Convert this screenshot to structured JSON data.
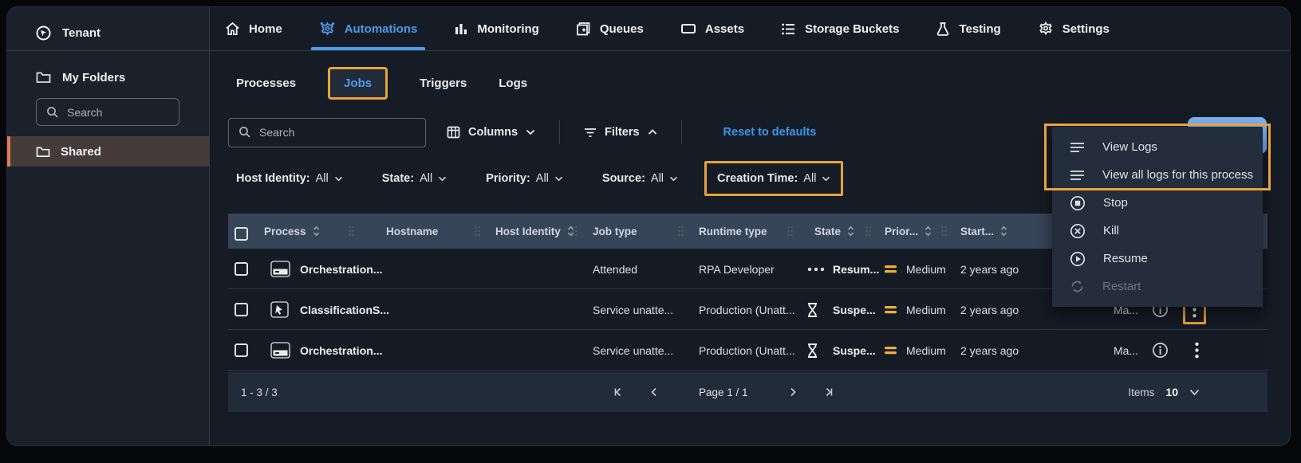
{
  "colors": {
    "accent_blue": "#4f9ae8",
    "link_blue": "#3e96e8",
    "annotation_orange": "#e8a33c",
    "priority_amber": "#efad3d",
    "shared_accent_orange": "#e07b52",
    "table_header_bg": "#384559"
  },
  "sidebar": {
    "tenant_label": "Tenant",
    "my_folders_label": "My Folders",
    "search_placeholder": "Search",
    "shared_label": "Shared"
  },
  "topnav": {
    "items": [
      {
        "label": "Home",
        "icon": "home-icon",
        "active": false
      },
      {
        "label": "Automations",
        "icon": "automations-gear-icon",
        "active": true
      },
      {
        "label": "Monitoring",
        "icon": "bar-chart-icon",
        "active": false
      },
      {
        "label": "Queues",
        "icon": "queues-icon",
        "active": false
      },
      {
        "label": "Assets",
        "icon": "assets-icon",
        "active": false
      },
      {
        "label": "Storage Buckets",
        "icon": "storage-buckets-icon",
        "active": false
      },
      {
        "label": "Testing",
        "icon": "flask-icon",
        "active": false
      },
      {
        "label": "Settings",
        "icon": "gear-icon",
        "active": false
      }
    ]
  },
  "tabs": {
    "items": [
      {
        "label": "Processes",
        "active": false
      },
      {
        "label": "Jobs",
        "active": true,
        "annotated": true
      },
      {
        "label": "Triggers",
        "active": false
      },
      {
        "label": "Logs",
        "active": false
      }
    ]
  },
  "toolbar": {
    "search_placeholder": "Search",
    "columns_label": "Columns",
    "filters_label": "Filters",
    "reset_label": "Reset to defaults"
  },
  "filters": {
    "items": [
      {
        "label": "Host Identity:",
        "value": "All",
        "annotated": false
      },
      {
        "label": "State:",
        "value": "All",
        "annotated": false
      },
      {
        "label": "Priority:",
        "value": "All",
        "annotated": false
      },
      {
        "label": "Source:",
        "value": "All",
        "annotated": false
      },
      {
        "label": "Creation Time:",
        "value": "All",
        "annotated": true
      }
    ]
  },
  "table": {
    "headers": {
      "process": "Process",
      "hostname": "Hostname",
      "host_identity": "Host Identity",
      "job_type": "Job type",
      "runtime_type": "Runtime type",
      "state": "State",
      "priority": "Prior...",
      "start": "Start..."
    },
    "rows": [
      {
        "process": "Orchestration...",
        "process_icon": "process-window-icon",
        "job_type": "Attended",
        "runtime_type": "RPA Developer",
        "state": "Resum...",
        "state_icon": "ellipsis-state-icon",
        "priority": "Medium",
        "start_time": "2 years ago"
      },
      {
        "process": "ClassificationS...",
        "process_icon": "process-cursor-icon",
        "job_type": "Service unatte...",
        "runtime_type": "Production (Unatt...",
        "state": "Suspe...",
        "state_icon": "hourglass-icon",
        "priority": "Medium",
        "start_time": "2 years ago",
        "machine": "Ma..."
      },
      {
        "process": "Orchestration...",
        "process_icon": "process-window-icon",
        "job_type": "Service unatte...",
        "runtime_type": "Production (Unatt...",
        "state": "Suspe...",
        "state_icon": "hourglass-icon",
        "priority": "Medium",
        "start_time": "2 years ago",
        "machine": "Ma..."
      }
    ]
  },
  "context_menu": {
    "items": [
      {
        "label": "View Logs",
        "icon": "logs-lines-icon",
        "disabled": false,
        "annotated": true
      },
      {
        "label": "View all logs for this process",
        "icon": "logs-lines-icon",
        "disabled": false,
        "annotated": true
      },
      {
        "label": "Stop",
        "icon": "stop-circle-icon",
        "disabled": false
      },
      {
        "label": "Kill",
        "icon": "kill-circle-icon",
        "disabled": false
      },
      {
        "label": "Resume",
        "icon": "resume-circle-icon",
        "disabled": false
      },
      {
        "label": "Restart",
        "icon": "restart-icon",
        "disabled": true
      }
    ]
  },
  "footer": {
    "range": "1 - 3 / 3",
    "page": "Page 1 / 1",
    "items_label": "Items",
    "items_per_page": "10"
  }
}
